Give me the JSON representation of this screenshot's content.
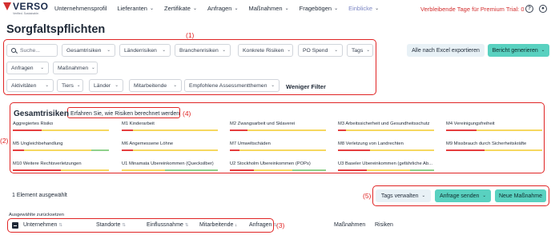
{
  "brand": {
    "name": "VERSO",
    "tagline": "Verified. Sustainable."
  },
  "nav": {
    "items": [
      {
        "label": "Unternehmensprofil",
        "has_dropdown": false
      },
      {
        "label": "Lieferanten",
        "has_dropdown": true
      },
      {
        "label": "Zertifikate",
        "has_dropdown": true
      },
      {
        "label": "Anfragen",
        "has_dropdown": true
      },
      {
        "label": "Maßnahmen",
        "has_dropdown": true
      },
      {
        "label": "Fragebögen",
        "has_dropdown": true
      },
      {
        "label": "Einblicke",
        "has_dropdown": true,
        "active": true
      }
    ],
    "trial_text": "Verbleibende Tage für Premium Trial: 0",
    "help_icon": "question-circle-icon",
    "user_icon": "user-circle-icon"
  },
  "page": {
    "title": "Sorgfaltspflichten"
  },
  "annotations": {
    "n1": "(1)",
    "n2": "(2)",
    "n3": "(3)",
    "n4": "(4)",
    "n5": "(5)"
  },
  "filters": {
    "search_placeholder": "Suche...",
    "row1": [
      "Gesamtrisiken",
      "Länderrisiken",
      "Branchenrisiken",
      "Konkrete Risiken",
      "PO Spend",
      "Tags"
    ],
    "row2": [
      "Anfragen",
      "Maßnahmen"
    ],
    "row3": [
      "Aktivitäten",
      "Tiers",
      "Länder",
      "Mitarbeitende",
      "Empfohlene Assessmentthemen"
    ],
    "less_filters": "Weniger Filter"
  },
  "actions": {
    "export_all": "Alle nach Excel exportieren",
    "generate_report": "Bericht generieren"
  },
  "risks": {
    "title": "Gesamtrisiken",
    "learn_link": "Erfahren Sie, wie Risiken berechnet werden",
    "colors": {
      "high": "#e53e3e",
      "medium": "#f6d860",
      "low": "#8fd18b"
    },
    "items": [
      {
        "label": "Aggregiertes Risiko",
        "red": 0.3,
        "yellow": 0.7,
        "green": 0.0
      },
      {
        "label": "M1 Kinderarbeit",
        "red": 0.12,
        "yellow": 0.88,
        "green": 0.0
      },
      {
        "label": "M2 Zwangsarbeit und Sklaverei",
        "red": 0.18,
        "yellow": 0.82,
        "green": 0.0
      },
      {
        "label": "M3 Arbeitssicherheit und Gesundheitsschutz",
        "red": 0.08,
        "yellow": 0.92,
        "green": 0.0
      },
      {
        "label": "M4 Vereinigungsfreiheit",
        "red": 0.32,
        "yellow": 0.68,
        "green": 0.0
      },
      {
        "label": "M5 Ungleichbehandlung",
        "red": 0.12,
        "yellow": 0.7,
        "green": 0.18
      },
      {
        "label": "M6 Angemessene Löhne",
        "red": 0.12,
        "yellow": 0.88,
        "green": 0.0
      },
      {
        "label": "M7 Umweltschäden",
        "red": 0.1,
        "yellow": 0.9,
        "green": 0.0
      },
      {
        "label": "M8 Verletzung von Landrechten",
        "red": 0.33,
        "yellow": 0.67,
        "green": 0.0
      },
      {
        "label": "M9 Missbrauch durch Sicherheitskräfte",
        "red": 0.4,
        "yellow": 0.6,
        "green": 0.0
      },
      {
        "label": "M10 Weitere Rechtsverletzungen",
        "red": 0.5,
        "yellow": 0.5,
        "green": 0.0
      },
      {
        "label": "U1 Minamata Übereinkommen (Quecksilber)",
        "red": 0.0,
        "yellow": 0.45,
        "green": 0.55
      },
      {
        "label": "U2 Stockholm Übereinkommen (POPs)",
        "red": 0.25,
        "yellow": 0.4,
        "green": 0.35
      },
      {
        "label": "U3 Baseler Übereinkommen (gefährliche Ab...",
        "red": 0.3,
        "yellow": 0.45,
        "green": 0.25
      }
    ]
  },
  "selection": {
    "count_text": "1 Element ausgewählt",
    "reset_text": "Ausgewählte zurücksetzen",
    "manage_tags": "Tags verwalten",
    "send_request": "Anfrage senden",
    "new_measure": "Neue Maßnahme"
  },
  "table": {
    "headers": [
      "Unternehmen",
      "Standorte",
      "Einflussnahme",
      "Mitarbeitende",
      "Anfragen",
      "Maßnahmen",
      "Risiken"
    ],
    "sorted_column": "Mitarbeitende",
    "sort_direction": "desc"
  }
}
